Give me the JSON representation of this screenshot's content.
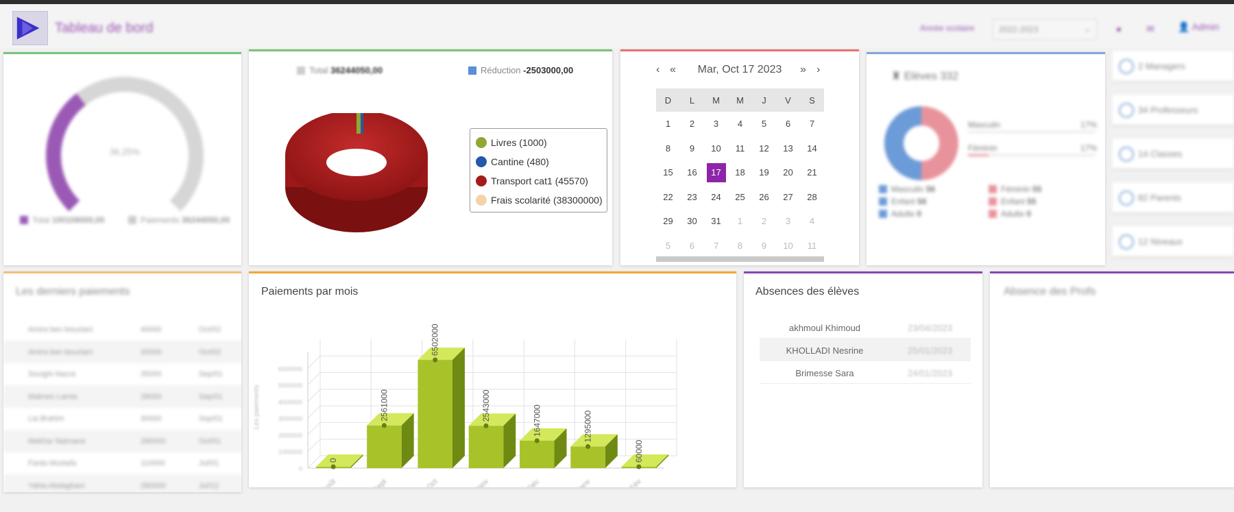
{
  "header": {
    "title": "Tableau de bord",
    "year_label": "Année scolaire",
    "year_value": "2022-2023",
    "user": "Admin"
  },
  "gauge": {
    "center_text": "36.25%",
    "level_fraction": 0.36,
    "legend": [
      {
        "label": "Total",
        "value": "100108000,00",
        "color": "#9b59b6"
      },
      {
        "label": "Paiements",
        "value": "36244050,00",
        "color": "#cccccc"
      }
    ]
  },
  "donut": {
    "total_label": "Total",
    "total_value": "36244050,00",
    "reduction_label": "Réduction",
    "reduction_value": "-2503000,00",
    "total_color": "#cccccc",
    "reduction_color": "#5b8fd6",
    "legend": [
      {
        "label": "Livres (1000)",
        "color": "#8fa832"
      },
      {
        "label": "Cantine (480)",
        "color": "#2359a8"
      },
      {
        "label": "Transport cat1 (45570)",
        "color": "#a11d1d"
      },
      {
        "label": "Frais scolarité (38300000)",
        "color": "#f5d2a8"
      }
    ]
  },
  "calendar": {
    "title": "Mar, Oct 17 2023",
    "prev": "‹",
    "prev_year": "«",
    "next_year": "»",
    "next": "›",
    "weekdays": [
      "D",
      "L",
      "M",
      "M",
      "J",
      "V",
      "S"
    ],
    "weeks": [
      [
        {
          "d": "1"
        },
        {
          "d": "2"
        },
        {
          "d": "3"
        },
        {
          "d": "4"
        },
        {
          "d": "5"
        },
        {
          "d": "6"
        },
        {
          "d": "7"
        }
      ],
      [
        {
          "d": "8"
        },
        {
          "d": "9"
        },
        {
          "d": "10"
        },
        {
          "d": "11"
        },
        {
          "d": "12"
        },
        {
          "d": "13"
        },
        {
          "d": "14"
        }
      ],
      [
        {
          "d": "15"
        },
        {
          "d": "16"
        },
        {
          "d": "17",
          "today": true
        },
        {
          "d": "18"
        },
        {
          "d": "19"
        },
        {
          "d": "20"
        },
        {
          "d": "21"
        }
      ],
      [
        {
          "d": "22"
        },
        {
          "d": "23"
        },
        {
          "d": "24"
        },
        {
          "d": "25"
        },
        {
          "d": "26"
        },
        {
          "d": "27"
        },
        {
          "d": "28"
        }
      ],
      [
        {
          "d": "29"
        },
        {
          "d": "30"
        },
        {
          "d": "31"
        },
        {
          "d": "1",
          "other": true
        },
        {
          "d": "2",
          "other": true
        },
        {
          "d": "3",
          "other": true
        },
        {
          "d": "4",
          "other": true
        }
      ],
      [
        {
          "d": "5",
          "other": true
        },
        {
          "d": "6",
          "other": true
        },
        {
          "d": "7",
          "other": true
        },
        {
          "d": "8",
          "other": true
        },
        {
          "d": "9",
          "other": true
        },
        {
          "d": "10",
          "other": true
        },
        {
          "d": "11",
          "other": true
        }
      ]
    ]
  },
  "students": {
    "title": "Elèves 332",
    "bar1_label": "Masculin",
    "bar1_value": "17%",
    "bar2_label": "Féminin",
    "bar2_value": "17%",
    "legend_left": [
      {
        "label": "Masculin",
        "value": "56"
      },
      {
        "label": "Enfant",
        "value": "56"
      },
      {
        "label": "Adulte",
        "value": "0"
      }
    ],
    "legend_right": [
      {
        "label": "Féminin",
        "value": "55"
      },
      {
        "label": "Enfant",
        "value": "55"
      },
      {
        "label": "Adulte",
        "value": "0"
      }
    ],
    "male_color": "#6b9bd8",
    "female_color": "#e8939b"
  },
  "counters": [
    {
      "label": "2 Managers"
    },
    {
      "label": "34 Professeurs"
    },
    {
      "label": "14 Classes"
    },
    {
      "label": "82 Parents"
    },
    {
      "label": "12 Niveaux"
    }
  ],
  "payments": {
    "title": "Les derniers paiements",
    "rows": [
      {
        "name": "Amira ben bouziani",
        "amount": "40000",
        "date": "Oct/02"
      },
      {
        "name": "Amira ben bouziani",
        "amount": "20000",
        "date": "Oct/02"
      },
      {
        "name": "Souighi Nacra",
        "amount": "35000",
        "date": "Sep/01"
      },
      {
        "name": "Maknes Lamia",
        "amount": "28000",
        "date": "Sep/01"
      },
      {
        "name": "Lia Brahim",
        "amount": "30000",
        "date": "Sep/01"
      },
      {
        "name": "Mekhar Naimane",
        "amount": "280000",
        "date": "Oct/01"
      },
      {
        "name": "Fanta Mustafa",
        "amount": "110000",
        "date": "Jul/01"
      },
      {
        "name": "Yahia Abdaghani",
        "amount": "280000",
        "date": "Jul/12"
      }
    ]
  },
  "payments_chart": {
    "title": "Paiements par mois",
    "ylabel": "Les paiements",
    "bar_color": "#a8c22a",
    "chart_data": {
      "type": "bar",
      "categories": [
        "Août",
        "Sept",
        "Oct",
        "Nov",
        "Déc",
        "Janv",
        "Fév"
      ],
      "values": [
        0,
        2561000,
        6502000,
        2543000,
        1647000,
        1295000,
        60000
      ],
      "value_labels": [
        "0",
        "2561000",
        "6502000",
        "2543000",
        "1647000",
        "1295000",
        "60000"
      ],
      "ylim": [
        0,
        7000000
      ],
      "yticks": [
        "0",
        "1000000",
        "2000000",
        "3000000",
        "4000000",
        "5000000",
        "6000000"
      ],
      "ylabel": "Les paiements"
    }
  },
  "absences": {
    "title": "Absences des élèves",
    "rows": [
      {
        "name": "akhmoul Khimoud",
        "date": "23/04/2023"
      },
      {
        "name": "KHOLLADI Nesrine",
        "date": "25/01/2023"
      },
      {
        "name": "Brimesse Sara",
        "date": "24/01/2023"
      }
    ]
  },
  "absences_profs": {
    "title": "Absence des Profs"
  }
}
